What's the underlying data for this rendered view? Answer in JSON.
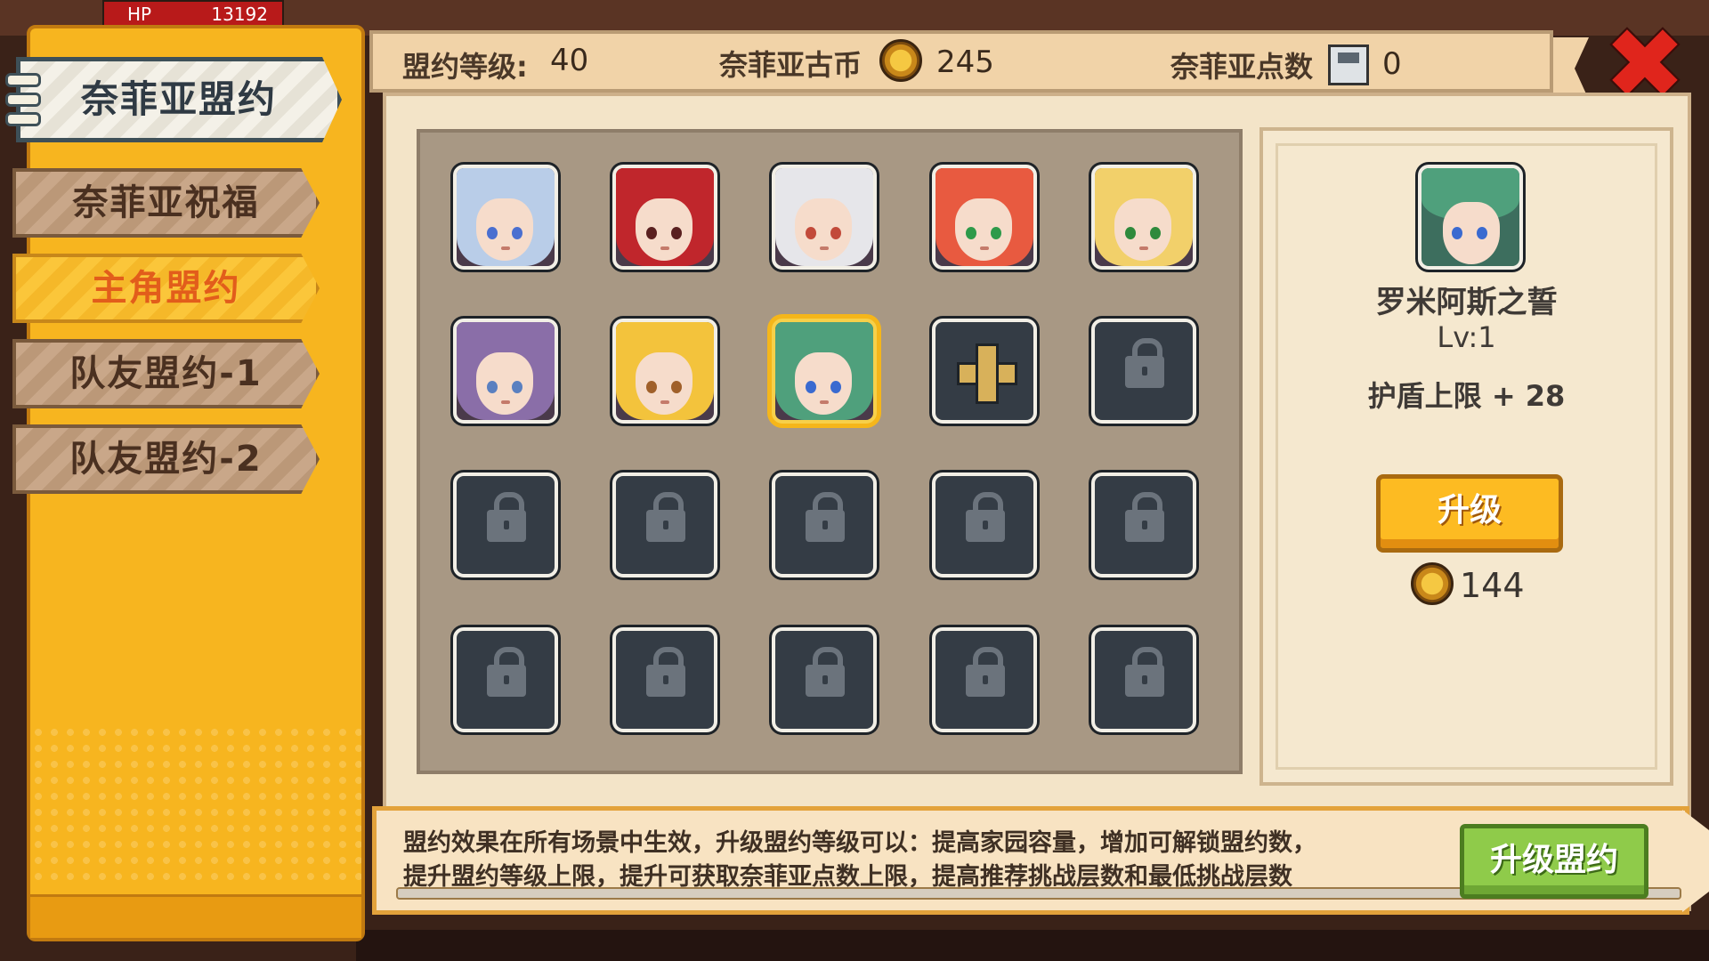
{
  "hud": {
    "hp_label": "HP",
    "hp_value": "13192"
  },
  "header": {
    "alliance_level_label": "盟约等级:",
    "alliance_level_value": "40",
    "coin_label": "奈菲亚古币",
    "coin_value": "245",
    "points_label": "奈菲亚点数",
    "points_value": "0"
  },
  "sidebar": {
    "title": "奈菲亚盟约",
    "items": [
      {
        "label": "奈菲亚祝福",
        "active": false
      },
      {
        "label": "主角盟约",
        "active": true
      },
      {
        "label": "队友盟约-1",
        "active": false
      },
      {
        "label": "队友盟约-2",
        "active": false
      }
    ]
  },
  "grid": {
    "slots": [
      {
        "state": "hero",
        "hair": "#b9cde8",
        "eye": "#4a6fd0"
      },
      {
        "state": "hero",
        "hair": "#c0262c",
        "eye": "#5a2020"
      },
      {
        "state": "hero",
        "hair": "#e6e6ea",
        "eye": "#c24a3a"
      },
      {
        "state": "hero",
        "hair": "#e85a40",
        "eye": "#2e9a4a"
      },
      {
        "state": "hero",
        "hair": "#f2d06a",
        "eye": "#2f8a3c"
      },
      {
        "state": "hero",
        "hair": "#8a6ea8",
        "eye": "#5a80c0"
      },
      {
        "state": "hero",
        "hair": "#f3c33c",
        "eye": "#a0602a"
      },
      {
        "state": "selected",
        "hair": "#4fa07c",
        "eye": "#3a6ad0"
      },
      {
        "state": "add"
      },
      {
        "state": "locked"
      },
      {
        "state": "locked"
      },
      {
        "state": "locked"
      },
      {
        "state": "locked"
      },
      {
        "state": "locked"
      },
      {
        "state": "locked"
      },
      {
        "state": "locked"
      },
      {
        "state": "locked"
      },
      {
        "state": "locked"
      },
      {
        "state": "locked"
      },
      {
        "state": "locked"
      }
    ]
  },
  "detail": {
    "name": "罗米阿斯之誓",
    "level": "Lv:1",
    "effect": "护盾上限 + 28",
    "upgrade_label": "升级",
    "cost": "144"
  },
  "info": {
    "line1": "盟约效果在所有场景中生效，升级盟约等级可以：提高家园容量，增加可解锁盟约数，",
    "line2": "提升盟约等级上限，提升可获取奈菲亚点数上限，提高推荐挑战层数和最低挑战层数",
    "upgrade_alliance_label": "升级盟约"
  },
  "colors": {
    "accent": "#f7b51f",
    "active_text": "#e25d1b",
    "green_button": "#8fcb4a",
    "close": "#e0251c"
  }
}
